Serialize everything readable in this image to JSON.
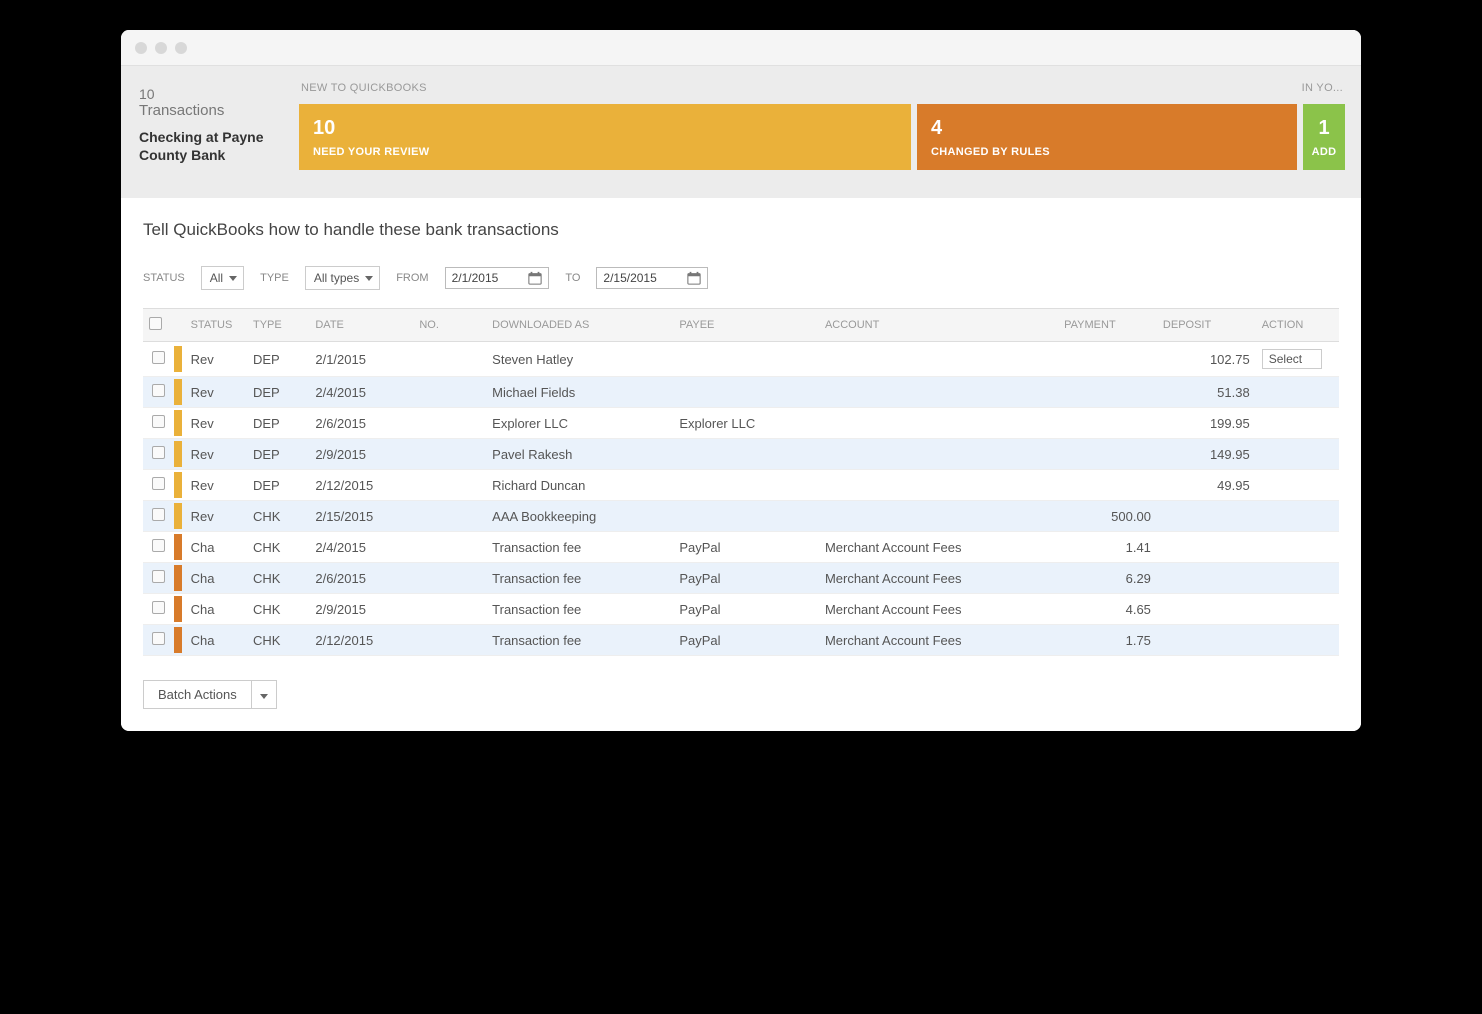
{
  "summary": {
    "count": "10",
    "count_label": "Transactions",
    "account_name": "Checking at Payne County Bank",
    "new_label": "NEW TO QUICKBOOKS",
    "in_yo": "IN YO...",
    "tiles": {
      "review": {
        "count": "10",
        "label": "NEED YOUR REVIEW"
      },
      "rules": {
        "count": "4",
        "label": "CHANGED BY RULES"
      },
      "add": {
        "count": "1",
        "label": "ADD"
      }
    }
  },
  "subtitle": "Tell QuickBooks how to handle these bank transactions",
  "filters": {
    "status_label": "STATUS",
    "status_value": "All",
    "type_label": "TYPE",
    "type_value": "All types",
    "from_label": "FROM",
    "from_value": "2/1/2015",
    "to_label": "TO",
    "to_value": "2/15/2015"
  },
  "columns": {
    "status": "STATUS",
    "type": "TYPE",
    "date": "DATE",
    "no": "NO.",
    "downloaded": "DOWNLOADED AS",
    "payee": "PAYEE",
    "account": "ACCOUNT",
    "payment": "PAYMENT",
    "deposit": "DEPOSIT",
    "action": "ACTION"
  },
  "rows": [
    {
      "bar": "y",
      "status": "Rev",
      "type": "DEP",
      "date": "2/1/2015",
      "no": "",
      "downloaded": "Steven Hatley",
      "payee": "",
      "account": "",
      "payment": "",
      "deposit": "102.75",
      "action": "Select"
    },
    {
      "bar": "y",
      "status": "Rev",
      "type": "DEP",
      "date": "2/4/2015",
      "no": "",
      "downloaded": "Michael Fields",
      "payee": "",
      "account": "",
      "payment": "",
      "deposit": "51.38",
      "action": ""
    },
    {
      "bar": "y",
      "status": "Rev",
      "type": "DEP",
      "date": "2/6/2015",
      "no": "",
      "downloaded": "Explorer LLC",
      "payee": "Explorer LLC",
      "account": "",
      "payment": "",
      "deposit": "199.95",
      "action": ""
    },
    {
      "bar": "y",
      "status": "Rev",
      "type": "DEP",
      "date": "2/9/2015",
      "no": "",
      "downloaded": "Pavel Rakesh",
      "payee": "",
      "account": "",
      "payment": "",
      "deposit": "149.95",
      "action": ""
    },
    {
      "bar": "y",
      "status": "Rev",
      "type": "DEP",
      "date": "2/12/2015",
      "no": "",
      "downloaded": "Richard Duncan",
      "payee": "",
      "account": "",
      "payment": "",
      "deposit": "49.95",
      "action": ""
    },
    {
      "bar": "y",
      "status": "Rev",
      "type": "CHK",
      "date": "2/15/2015",
      "no": "",
      "downloaded": "AAA Bookkeeping",
      "payee": "",
      "account": "",
      "payment": "500.00",
      "deposit": "",
      "action": ""
    },
    {
      "bar": "o",
      "status": "Cha",
      "type": "CHK",
      "date": "2/4/2015",
      "no": "",
      "downloaded": "Transaction fee",
      "payee": "PayPal",
      "account": "Merchant Account Fees",
      "payment": "1.41",
      "deposit": "",
      "action": ""
    },
    {
      "bar": "o",
      "status": "Cha",
      "type": "CHK",
      "date": "2/6/2015",
      "no": "",
      "downloaded": "Transaction fee",
      "payee": "PayPal",
      "account": "Merchant Account Fees",
      "payment": "6.29",
      "deposit": "",
      "action": ""
    },
    {
      "bar": "o",
      "status": "Cha",
      "type": "CHK",
      "date": "2/9/2015",
      "no": "",
      "downloaded": "Transaction fee",
      "payee": "PayPal",
      "account": "Merchant Account Fees",
      "payment": "4.65",
      "deposit": "",
      "action": ""
    },
    {
      "bar": "o",
      "status": "Cha",
      "type": "CHK",
      "date": "2/12/2015",
      "no": "",
      "downloaded": "Transaction fee",
      "payee": "PayPal",
      "account": "Merchant Account Fees",
      "payment": "1.75",
      "deposit": "",
      "action": ""
    }
  ],
  "batch_actions": "Batch Actions"
}
